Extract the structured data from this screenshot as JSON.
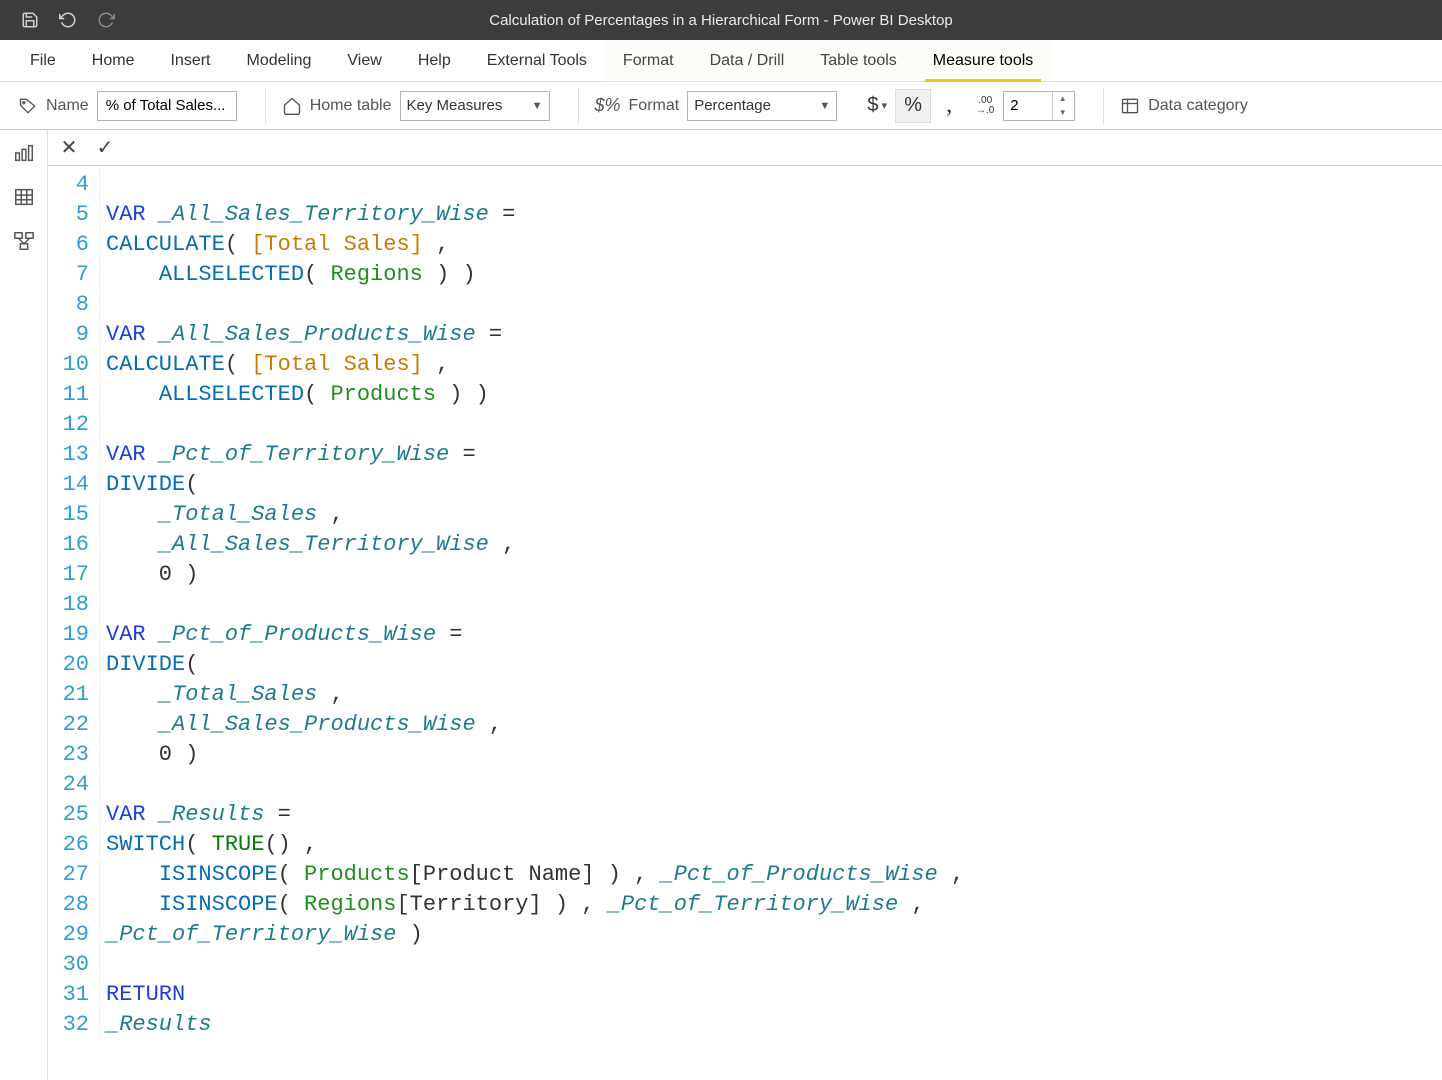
{
  "title": "Calculation of Percentages in a Hierarchical Form - Power BI Desktop",
  "ribbon": {
    "tabs": [
      "File",
      "Home",
      "Insert",
      "Modeling",
      "View",
      "Help",
      "External Tools",
      "Format",
      "Data / Drill",
      "Table tools",
      "Measure tools"
    ],
    "active": "Measure tools",
    "contextualStart": 7
  },
  "tools": {
    "nameLabel": "Name",
    "nameValue": "% of Total Sales...",
    "homeTableLabel": "Home table",
    "homeTableValue": "Key Measures",
    "formatLabel": "Format",
    "formatValue": "Percentage",
    "currencyCode": "$",
    "decimalValue": "2",
    "dataCategoryLabel": "Data category"
  },
  "code": {
    "lines": [
      {
        "n": 4,
        "tokens": []
      },
      {
        "n": 5,
        "tokens": [
          {
            "t": "VAR",
            "c": "kw-var"
          },
          {
            "t": " ",
            "c": "punct"
          },
          {
            "t": "_All_Sales_Territory_Wise",
            "c": "varref"
          },
          {
            "t": " =",
            "c": "punct"
          }
        ]
      },
      {
        "n": 6,
        "tokens": [
          {
            "t": "CALCULATE",
            "c": "kw-fn"
          },
          {
            "t": "( ",
            "c": "punct"
          },
          {
            "t": "[Total Sales]",
            "c": "meas"
          },
          {
            "t": " ,",
            "c": "punct"
          }
        ]
      },
      {
        "n": 7,
        "tokens": [
          {
            "t": "    ",
            "c": "punct"
          },
          {
            "t": "ALLSELECTED",
            "c": "kw-fn"
          },
          {
            "t": "( ",
            "c": "punct"
          },
          {
            "t": "Regions",
            "c": "tbl"
          },
          {
            "t": " ) )",
            "c": "punct"
          }
        ]
      },
      {
        "n": 8,
        "tokens": []
      },
      {
        "n": 9,
        "tokens": [
          {
            "t": "VAR",
            "c": "kw-var"
          },
          {
            "t": " ",
            "c": "punct"
          },
          {
            "t": "_All_Sales_Products_Wise",
            "c": "varref"
          },
          {
            "t": " =",
            "c": "punct"
          }
        ]
      },
      {
        "n": 10,
        "tokens": [
          {
            "t": "CALCULATE",
            "c": "kw-fn"
          },
          {
            "t": "( ",
            "c": "punct"
          },
          {
            "t": "[Total Sales]",
            "c": "meas"
          },
          {
            "t": " ,",
            "c": "punct"
          }
        ]
      },
      {
        "n": 11,
        "tokens": [
          {
            "t": "    ",
            "c": "punct"
          },
          {
            "t": "ALLSELECTED",
            "c": "kw-fn"
          },
          {
            "t": "( ",
            "c": "punct"
          },
          {
            "t": "Products",
            "c": "tbl"
          },
          {
            "t": " ) )",
            "c": "punct"
          }
        ]
      },
      {
        "n": 12,
        "tokens": []
      },
      {
        "n": 13,
        "tokens": [
          {
            "t": "VAR",
            "c": "kw-var"
          },
          {
            "t": " ",
            "c": "punct"
          },
          {
            "t": "_Pct_of_Territory_Wise",
            "c": "varref"
          },
          {
            "t": " =",
            "c": "punct"
          }
        ]
      },
      {
        "n": 14,
        "tokens": [
          {
            "t": "DIVIDE",
            "c": "kw-fn"
          },
          {
            "t": "(",
            "c": "punct"
          }
        ]
      },
      {
        "n": 15,
        "tokens": [
          {
            "t": "    ",
            "c": "punct"
          },
          {
            "t": "_Total_Sales",
            "c": "varref"
          },
          {
            "t": " ,",
            "c": "punct"
          }
        ]
      },
      {
        "n": 16,
        "tokens": [
          {
            "t": "    ",
            "c": "punct"
          },
          {
            "t": "_All_Sales_Territory_Wise",
            "c": "varref"
          },
          {
            "t": " ,",
            "c": "punct"
          }
        ]
      },
      {
        "n": 17,
        "tokens": [
          {
            "t": "    0 )",
            "c": "punct"
          }
        ]
      },
      {
        "n": 18,
        "tokens": []
      },
      {
        "n": 19,
        "tokens": [
          {
            "t": "VAR",
            "c": "kw-var"
          },
          {
            "t": " ",
            "c": "punct"
          },
          {
            "t": "_Pct_of_Products_Wise",
            "c": "varref"
          },
          {
            "t": " =",
            "c": "punct"
          }
        ]
      },
      {
        "n": 20,
        "tokens": [
          {
            "t": "DIVIDE",
            "c": "kw-fn"
          },
          {
            "t": "(",
            "c": "punct"
          }
        ]
      },
      {
        "n": 21,
        "tokens": [
          {
            "t": "    ",
            "c": "punct"
          },
          {
            "t": "_Total_Sales",
            "c": "varref"
          },
          {
            "t": " ,",
            "c": "punct"
          }
        ]
      },
      {
        "n": 22,
        "tokens": [
          {
            "t": "    ",
            "c": "punct"
          },
          {
            "t": "_All_Sales_Products_Wise",
            "c": "varref"
          },
          {
            "t": " ,",
            "c": "punct"
          }
        ]
      },
      {
        "n": 23,
        "tokens": [
          {
            "t": "    0 )",
            "c": "punct"
          }
        ]
      },
      {
        "n": 24,
        "tokens": []
      },
      {
        "n": 25,
        "tokens": [
          {
            "t": "VAR",
            "c": "kw-var"
          },
          {
            "t": " ",
            "c": "punct"
          },
          {
            "t": "_Results",
            "c": "varref"
          },
          {
            "t": " =",
            "c": "punct"
          }
        ]
      },
      {
        "n": 26,
        "tokens": [
          {
            "t": "SWITCH",
            "c": "kw-fn"
          },
          {
            "t": "( ",
            "c": "punct"
          },
          {
            "t": "TRUE",
            "c": "kw-true"
          },
          {
            "t": "() ,",
            "c": "punct"
          }
        ]
      },
      {
        "n": 27,
        "tokens": [
          {
            "t": "    ",
            "c": "punct"
          },
          {
            "t": "ISINSCOPE",
            "c": "kw-fn"
          },
          {
            "t": "( ",
            "c": "punct"
          },
          {
            "t": "Products",
            "c": "tbl"
          },
          {
            "t": "[Product Name] ) , ",
            "c": "punct"
          },
          {
            "t": "_Pct_of_Products_Wise",
            "c": "varref"
          },
          {
            "t": " ,",
            "c": "punct"
          }
        ]
      },
      {
        "n": 28,
        "tokens": [
          {
            "t": "    ",
            "c": "punct"
          },
          {
            "t": "ISINSCOPE",
            "c": "kw-fn"
          },
          {
            "t": "( ",
            "c": "punct"
          },
          {
            "t": "Regions",
            "c": "tbl"
          },
          {
            "t": "[Territory] ) , ",
            "c": "punct"
          },
          {
            "t": "_Pct_of_Territory_Wise",
            "c": "varref"
          },
          {
            "t": " ,",
            "c": "punct"
          }
        ]
      },
      {
        "n": 29,
        "tokens": [
          {
            "t": "_Pct_of_Territory_Wise",
            "c": "varref"
          },
          {
            "t": " )",
            "c": "punct"
          }
        ]
      },
      {
        "n": 30,
        "tokens": []
      },
      {
        "n": 31,
        "tokens": [
          {
            "t": "RETURN",
            "c": "ret"
          }
        ]
      },
      {
        "n": 32,
        "tokens": [
          {
            "t": "_Results",
            "c": "varref"
          }
        ]
      }
    ]
  }
}
